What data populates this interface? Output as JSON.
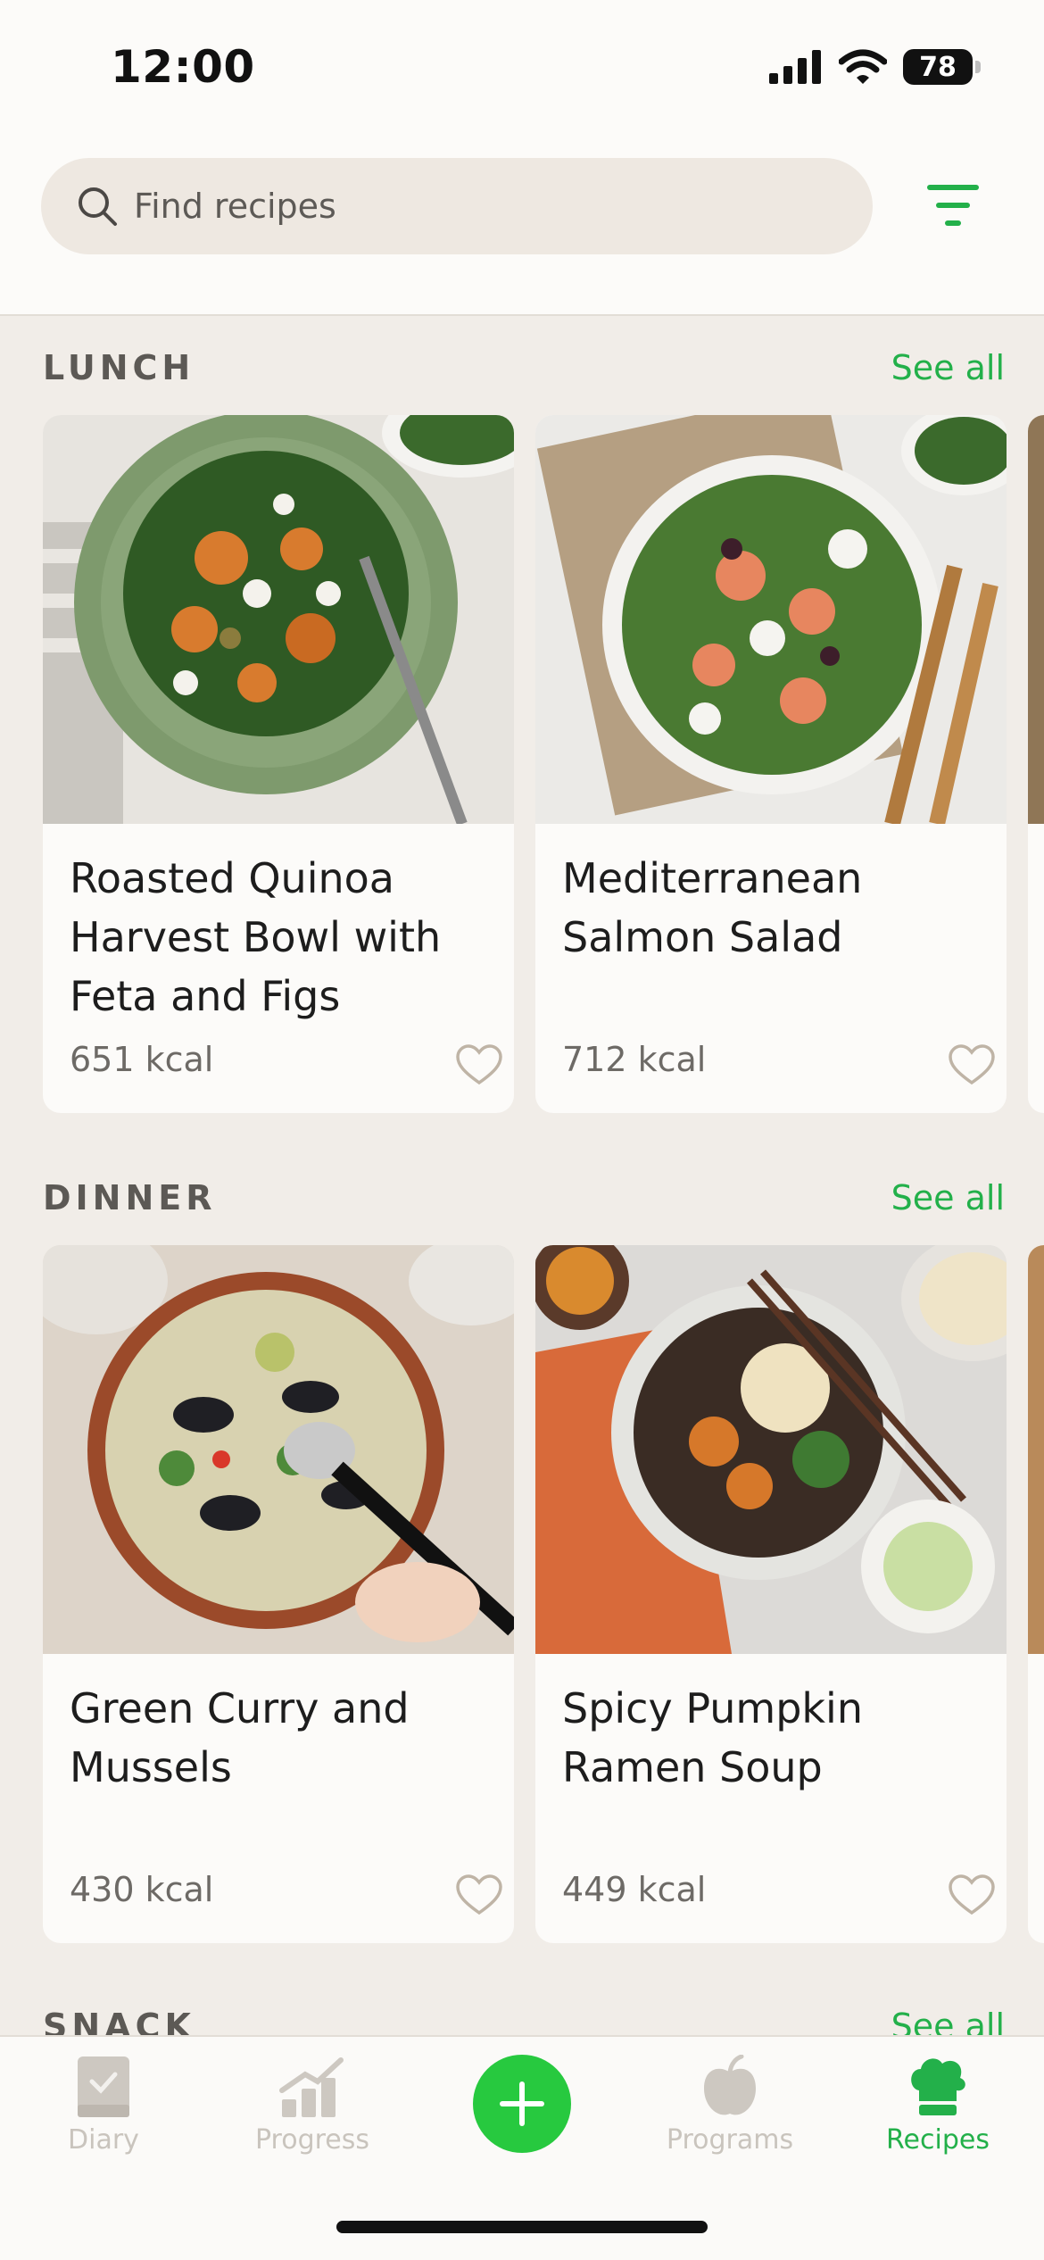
{
  "status_bar": {
    "time": "12:00",
    "battery": "78",
    "icons": [
      "signal-icon",
      "wifi-icon",
      "battery-icon"
    ]
  },
  "search": {
    "placeholder": "Find recipes",
    "icon": "search-icon"
  },
  "filter": {
    "icon": "filter-icon"
  },
  "colors": {
    "accent": "#23b04a",
    "add_button": "#27c93f",
    "background": "#f1ede8",
    "card": "#fcfbf9"
  },
  "sections": [
    {
      "title": "LUNCH",
      "see_all": "See all",
      "cards": [
        {
          "title": "Roasted Quinoa Harvest Bowl with Feta and Figs",
          "kcal": "651 kcal",
          "image": "quinoa-bowl-photo"
        },
        {
          "title": "Mediterranean Salmon Salad",
          "kcal": "712 kcal",
          "image": "salmon-salad-photo"
        }
      ]
    },
    {
      "title": "DINNER",
      "see_all": "See all",
      "cards": [
        {
          "title": "Green Curry and Mussels",
          "kcal": "430 kcal",
          "image": "mussels-curry-photo"
        },
        {
          "title": "Spicy Pumpkin Ramen Soup",
          "kcal": "449 kcal",
          "image": "pumpkin-ramen-photo"
        }
      ]
    },
    {
      "title": "SNACK",
      "see_all": "See all"
    }
  ],
  "tabbar": {
    "items": [
      {
        "label": "Diary",
        "icon": "diary-icon"
      },
      {
        "label": "Progress",
        "icon": "progress-chart-icon"
      },
      {
        "label": "",
        "icon": "plus-icon"
      },
      {
        "label": "Programs",
        "icon": "apple-icon"
      },
      {
        "label": "Recipes",
        "icon": "chef-hat-icon"
      }
    ],
    "active": "Recipes"
  }
}
